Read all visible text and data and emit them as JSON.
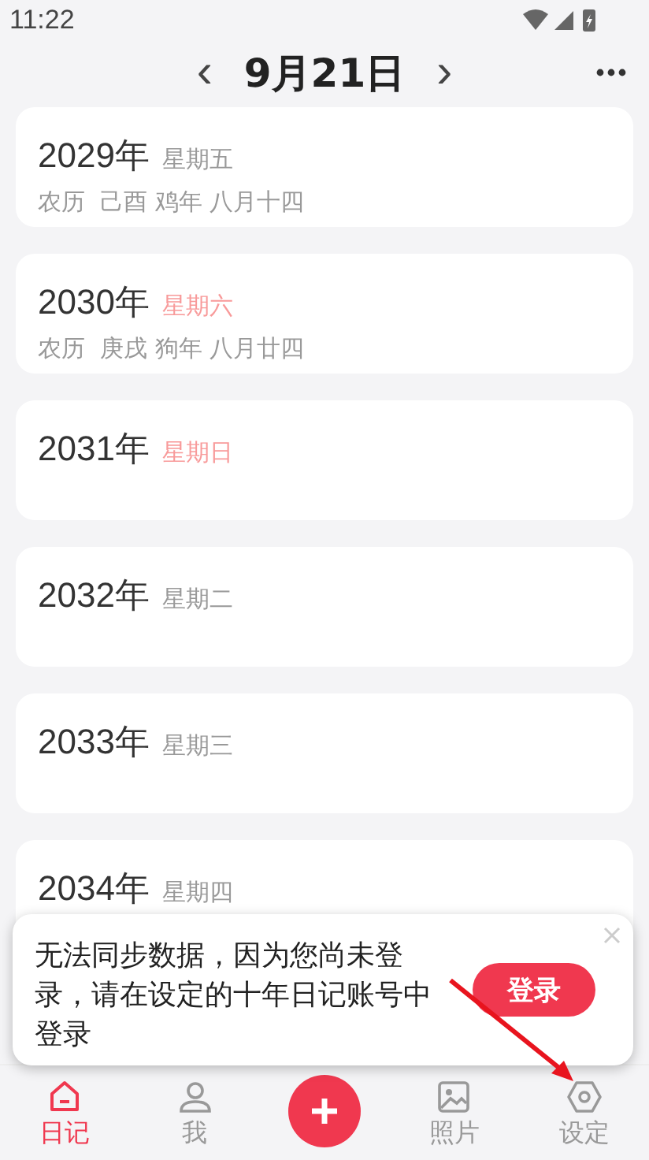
{
  "status_bar": {
    "time": "11:22"
  },
  "header": {
    "prev": "‹",
    "title": "9月21日",
    "next": "›"
  },
  "entries": [
    {
      "year": "2029年",
      "weekday": "星期五",
      "color": "#999999",
      "lunar": "农历  己酉 鸡年 八月十四"
    },
    {
      "year": "2030年",
      "weekday": "星期六",
      "color": "#f89a9a",
      "lunar": "农历  庚戌 狗年 八月廿四"
    },
    {
      "year": "2031年",
      "weekday": "星期日",
      "color": "#f89a9a"
    },
    {
      "year": "2032年",
      "weekday": "星期二",
      "color": "#999999"
    },
    {
      "year": "2033年",
      "weekday": "星期三",
      "color": "#999999"
    },
    {
      "year": "2034年",
      "weekday": "星期四",
      "color": "#999999"
    }
  ],
  "popup": {
    "message": "无法同步数据，因为您尚未登录，请在设定的十年日记账号中登录",
    "button": "登录"
  },
  "tabs": [
    {
      "kind": "diary",
      "label": "日记",
      "selected": true
    },
    {
      "kind": "me",
      "label": "我",
      "selected": false
    },
    {
      "kind": "add"
    },
    {
      "kind": "photos",
      "label": "照片",
      "selected": false
    },
    {
      "kind": "settings",
      "label": "设定",
      "selected": false
    }
  ]
}
